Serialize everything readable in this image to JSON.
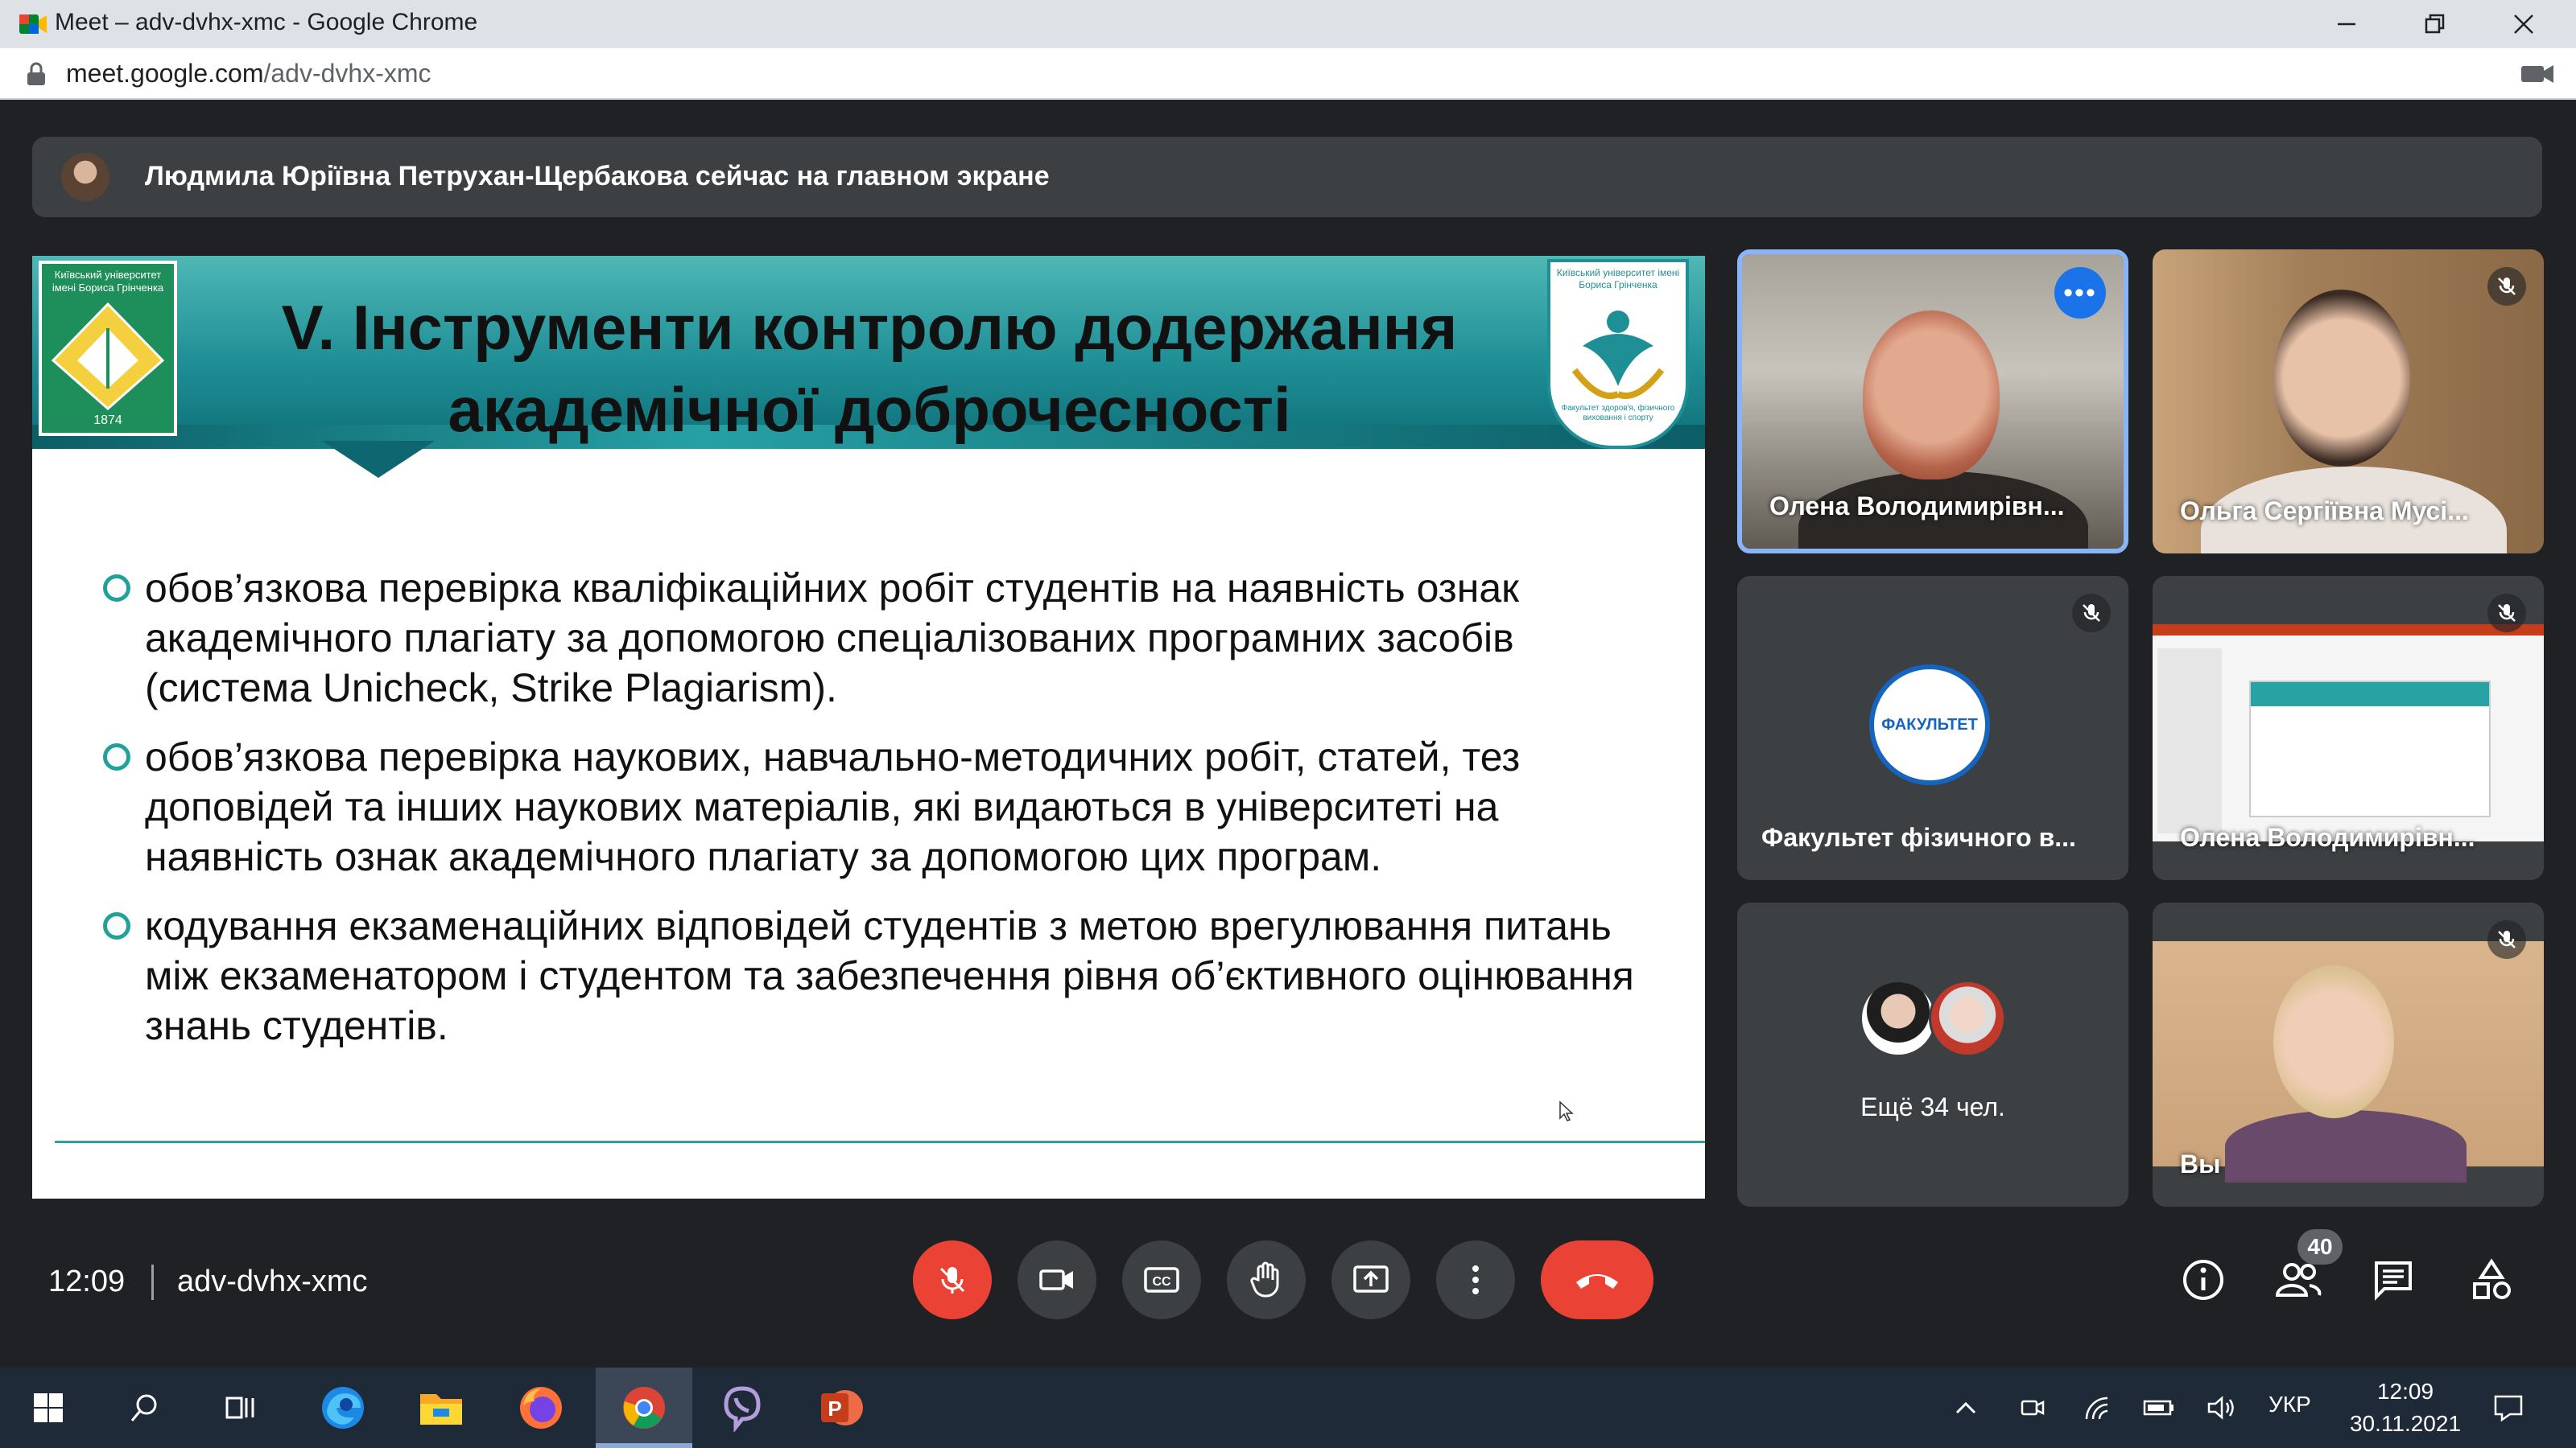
{
  "window": {
    "title": "Meet – adv-dvhx-xmc - Google Chrome",
    "url_host": "meet.google.com",
    "url_path": "/adv-dvhx-xmc"
  },
  "banner": {
    "text": "Людмила Юріївна Петрухан-Щербакова сейчас на главном экране"
  },
  "slide": {
    "title_line1": "V. Інструменти контролю додержання",
    "title_line2": "академічної доброчесності",
    "logo_left_text": "Київський університет імені Бориса Грінченка",
    "logo_left_year": "1874",
    "logo_right_top": "Київський університет імені Бориса Грінченка",
    "logo_right_bottom": "Факультет здоров'я, фізичного виховання і спорту",
    "bullets": [
      "обов’язкова перевірка кваліфікаційних робіт студентів на наявність ознак академічного плагіату за допомогою спеціалізованих програмних засобів (система Unicheck, Strike Plagiarism).",
      "обов’язкова перевірка наукових, навчально-методичних робіт, статей, тез доповідей та інших наукових матеріалів, які видаються в університеті на наявність ознак академічного плагіату за допомогою цих програм.",
      "кодування екзаменаційних відповідей студентів з метою врегулювання питань між екзаменатором і студентом та забезпечення рівня об’єктивного оцінювання знань студентів."
    ]
  },
  "participants": [
    {
      "name": "Олена Володимирівн...",
      "muted": false,
      "active": true
    },
    {
      "name": "Ольга Сергіївна Мусі...",
      "muted": true
    },
    {
      "name": "Факультет фізичного в...",
      "muted": true,
      "logo_text": "ФАКУЛЬТЕТ"
    },
    {
      "name": "Олена Володимирівн...",
      "muted": true
    },
    {
      "name": "Ещё 34 чел."
    },
    {
      "name": "Вы",
      "muted": true
    }
  ],
  "bottom_bar": {
    "time": "12:09",
    "meeting_code": "adv-dvhx-xmc",
    "people_count": "40"
  },
  "taskbar": {
    "lang": "УКР",
    "time": "12:09",
    "date": "30.11.2021"
  },
  "colors": {
    "meet_bg": "#202124",
    "tile_bg": "#3c4043",
    "danger": "#ea4335",
    "active_border": "#8ab4f8",
    "slide_teal": "#1f8f96"
  }
}
